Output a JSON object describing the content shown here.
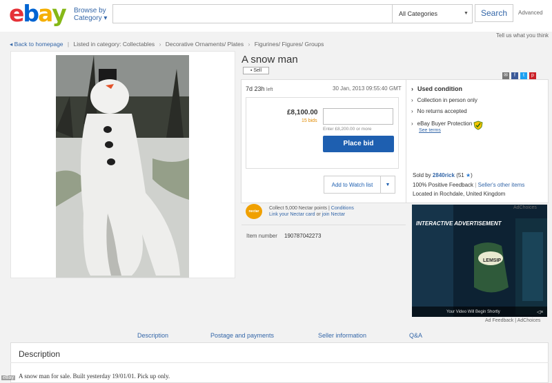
{
  "header": {
    "logo": [
      "e",
      "b",
      "a",
      "y"
    ],
    "logo_colors": [
      "#e53238",
      "#0064d2",
      "#f5af02",
      "#86b817"
    ],
    "browse_label_1": "Browse by",
    "browse_label_2": "Category ▾",
    "search_placeholder": "",
    "category_selected": "All Categories",
    "search_button": "Search",
    "advanced": "Advanced",
    "tell_us": "Tell us what you think"
  },
  "breadcrumb": {
    "back": "Back to homepage",
    "listed_in": "Listed in category:",
    "items": [
      "Collectables",
      "Decorative Ornaments/ Plates",
      "Figurines/ Figures/ Groups"
    ]
  },
  "listing": {
    "title": "A snow man",
    "sell_badge": "Sell",
    "time_left": "7d 23h",
    "time_left_suffix": "left",
    "end_date": "30 Jan, 2013 09:55:40 GMT",
    "price": "£8,100.00",
    "bids": "15 bids",
    "enter_hint": "Enter £8,200.00 or more",
    "place_bid": "Place bid",
    "watch_list": "Add to Watch list",
    "item_number_label": "Item number",
    "item_number": "190787042273"
  },
  "info": {
    "condition": "Used condition",
    "collection": "Collection in person only",
    "returns": "No returns accepted",
    "protection": "eBay Buyer Protection",
    "see_terms": "See terms",
    "sold_by_prefix": "Sold by",
    "seller": "2840rick",
    "seller_score": "(51",
    "seller_score_end": ")",
    "feedback": "100% Positive Feedback",
    "other_items": "Seller's other items",
    "location": "Located in Rochdale, United Kingdom"
  },
  "nectar": {
    "logo": "nectar",
    "line1": "Collect 5,000 Nectar points",
    "conditions": "Conditions",
    "link_card": "Link your Nectar card",
    "or": "or",
    "join": "join Nectar"
  },
  "ad": {
    "ad_choices_top": "AdChoices",
    "banner": "INTERACTIVE ADVERTISEMENT",
    "brand": "LEMSIP",
    "bottom": "Your Video Will Begin Shortly",
    "feedback": "Ad Feedback",
    "ad_choices": "AdChoices"
  },
  "tabs": [
    "Description",
    "Postage and payments",
    "Seller information",
    "Q&A"
  ],
  "description": {
    "title": "Description",
    "text": "A snow man for sale. Built yesterday 19/01/01. Pick up only."
  },
  "credit": "eBay",
  "colors": {
    "link": "#3366a8",
    "primary_button": "#1e5fb0",
    "bids": "#e08a00"
  }
}
